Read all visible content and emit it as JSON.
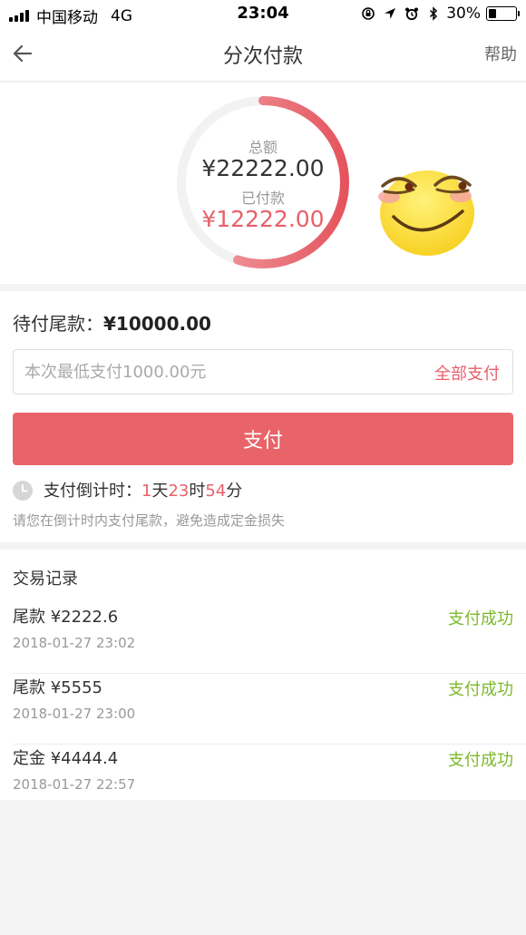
{
  "status_bar": {
    "carrier": "中国移动",
    "network": "4G",
    "time": "23:04",
    "battery": "30%",
    "battery_level": 0.3
  },
  "nav": {
    "title": "分次付款",
    "help": "帮助"
  },
  "summary": {
    "total_label": "总额",
    "total_value": "¥22222.00",
    "paid_label": "已付款",
    "paid_value": "¥12222.00",
    "paid_fraction": 0.55,
    "accent_color": "#e8606a"
  },
  "payment": {
    "remaining_label": "待付尾款：",
    "remaining_value": "¥10000.00",
    "input_placeholder": "本次最低支付1000.00元",
    "pay_all_label": "全部支付",
    "pay_button_label": "支付",
    "countdown_label": "支付倒计时：",
    "countdown_days": "1",
    "countdown_day_unit": "天",
    "countdown_hours": "23",
    "countdown_hour_unit": "时",
    "countdown_minutes": "54",
    "countdown_minute_unit": "分",
    "hint": "请您在倒计时内支付尾款，避免造成定金损失"
  },
  "records": {
    "title": "交易记录",
    "items": [
      {
        "title": "尾款 ¥2222.6",
        "time": "2018-01-27 23:02",
        "status": "支付成功"
      },
      {
        "title": "尾款 ¥5555",
        "time": "2018-01-27 23:00",
        "status": "支付成功"
      },
      {
        "title": "定金 ¥4444.4",
        "time": "2018-01-27 22:57",
        "status": "支付成功"
      }
    ],
    "status_color": "#7cb92a"
  }
}
